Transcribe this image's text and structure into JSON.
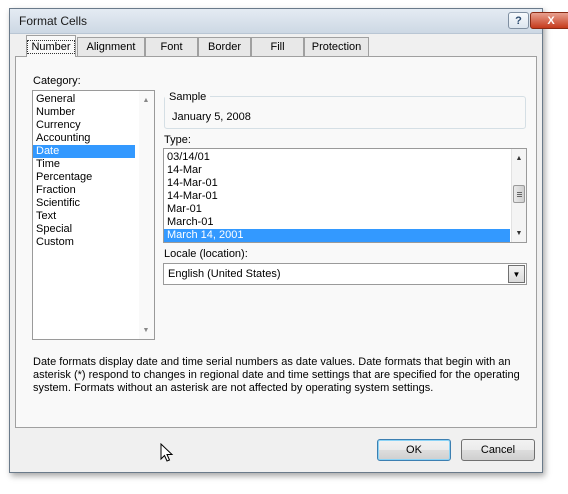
{
  "window": {
    "title": "Format Cells",
    "help_label": "?",
    "close_label": "X"
  },
  "tabs": [
    {
      "label": "Number",
      "active": true
    },
    {
      "label": "Alignment"
    },
    {
      "label": "Font"
    },
    {
      "label": "Border"
    },
    {
      "label": "Fill"
    },
    {
      "label": "Protection"
    }
  ],
  "category": {
    "label": "Category:",
    "items": [
      "General",
      "Number",
      "Currency",
      "Accounting",
      "Date",
      "Time",
      "Percentage",
      "Fraction",
      "Scientific",
      "Text",
      "Special",
      "Custom"
    ],
    "selected": "Date"
  },
  "sample": {
    "label": "Sample",
    "value": "January 5, 2008"
  },
  "type": {
    "label": "Type:",
    "items": [
      "03/14/01",
      "14-Mar",
      "14-Mar-01",
      "14-Mar-01",
      "Mar-01",
      "March-01",
      "March 14, 2001"
    ],
    "selected": "March 14, 2001"
  },
  "locale": {
    "label": "Locale (location):",
    "value": "English (United States)"
  },
  "description": "Date formats display date and time serial numbers as date values.  Date formats that begin with an asterisk (*) respond to changes in regional date and time settings that are specified for the operating system. Formats without an asterisk are not affected by operating system settings.",
  "buttons": {
    "ok": "OK",
    "cancel": "Cancel"
  },
  "icons": {
    "scroll_up": "triangle-up-icon",
    "scroll_down": "triangle-down-icon",
    "dropdown": "chevron-down-icon",
    "cursor": "mouse-pointer-icon"
  },
  "colors": {
    "selection": "#3399ff",
    "close": "#c53a1c"
  }
}
